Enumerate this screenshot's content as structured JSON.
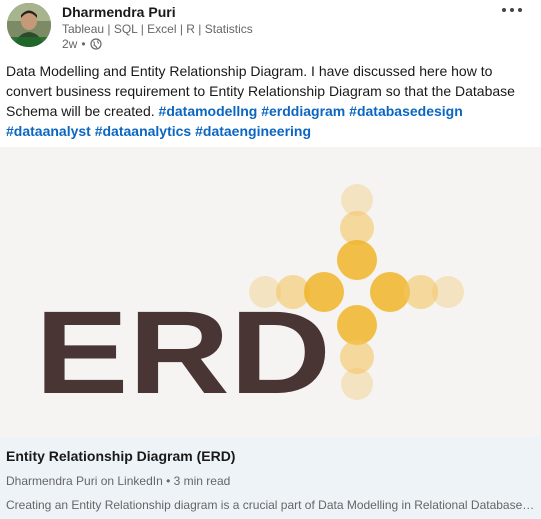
{
  "author": {
    "name": "Dharmendra Puri",
    "headline": "Tableau | SQL | Excel | R | Statistics",
    "post_age": "2w"
  },
  "post": {
    "text_prefix": "Data Modelling and Entity Relationship Diagram. I have discussed here how to convert business requirement to Entity Relationship Diagram so that the Database Schema will be created.",
    "hashtags": [
      "#datamodellng",
      "#erddiagram",
      "#databasedesign",
      "#dataanalyst",
      "#dataanalytics",
      "#dataengineering"
    ]
  },
  "image": {
    "logo_text": "ERD",
    "logo_color": "#4a3535",
    "dot_color": "#f0b429"
  },
  "article": {
    "title": "Entity Relationship Diagram (ERD)",
    "source": "Dharmendra Puri on LinkedIn • 3 min read",
    "snippet": "Creating an Entity Relationship diagram is a crucial part of Data Modelling in Relational Database…"
  },
  "colors": {
    "hashtag": "#0a66c2",
    "footer_bg": "#eef3f8",
    "muted_text": "#666666"
  }
}
